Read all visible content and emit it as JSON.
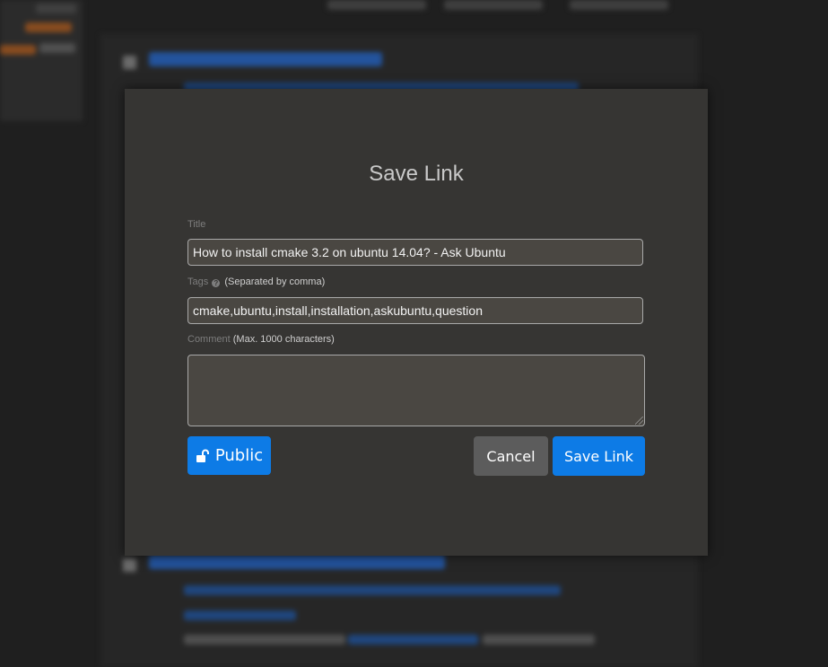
{
  "modal": {
    "title": "Save Link",
    "title_field": {
      "label": "Title",
      "value": "How to install cmake 3.2 on ubuntu 14.04? - Ask Ubuntu"
    },
    "tags_field": {
      "label": "Tags",
      "hint": "(Separated by comma)",
      "value": "cmake,ubuntu,install,installation,askubuntu,question"
    },
    "comment_field": {
      "label": "Comment",
      "hint": "(Max. 1000 characters)",
      "value": ""
    },
    "buttons": {
      "visibility": "Public",
      "cancel": "Cancel",
      "save": "Save Link"
    }
  },
  "colors": {
    "accent": "#0d7be6",
    "modal_bg": "#363533",
    "input_bg": "#4a4742",
    "cancel_bg": "#5c5c5c"
  },
  "icons": {
    "visibility": "unlocked-padlock-icon",
    "help": "question-circle-icon"
  }
}
